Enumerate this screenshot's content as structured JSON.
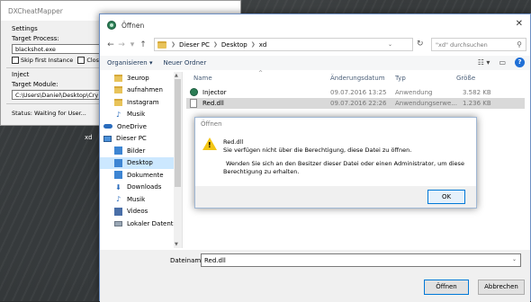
{
  "desktop": {
    "label": "xd"
  },
  "dx_window": {
    "title": "DXCheatMapper",
    "settings_label": "Settings",
    "target_process_label": "Target Process:",
    "target_process_value": "blackshot.exe",
    "skip_first_instance": "Skip first Instance",
    "close_after": "Close af",
    "inject_label": "Inject",
    "target_module_label": "Target Module:",
    "target_module_value": "C:\\Users\\Daniel\\Desktop\\Cry Bal",
    "status": "Status: Waiting for User..."
  },
  "open_dialog": {
    "title": "Öffnen",
    "breadcrumb": [
      "Dieser PC",
      "Desktop",
      "xd"
    ],
    "search_placeholder": "\"xd\" durchsuchen",
    "toolbar": {
      "organize": "Organisieren ▾",
      "new_folder": "Neuer Ordner"
    },
    "tree": [
      {
        "label": "3europ",
        "icon": "folder-icon"
      },
      {
        "label": "aufnahmen",
        "icon": "folder-icon"
      },
      {
        "label": "Instagram",
        "icon": "folder-icon"
      },
      {
        "label": "Musik",
        "icon": "music-icon"
      },
      {
        "label": "OneDrive",
        "icon": "cloud-icon"
      },
      {
        "label": "Dieser PC",
        "icon": "pc-icon"
      },
      {
        "label": "Bilder",
        "icon": "pictures-icon"
      },
      {
        "label": "Desktop",
        "icon": "desktop-icon"
      },
      {
        "label": "Dokumente",
        "icon": "documents-icon"
      },
      {
        "label": "Downloads",
        "icon": "downloads-icon"
      },
      {
        "label": "Musik",
        "icon": "music-icon"
      },
      {
        "label": "Videos",
        "icon": "videos-icon"
      },
      {
        "label": "Lokaler Datenträ",
        "icon": "drive-icon"
      }
    ],
    "columns": {
      "name": "Name",
      "date": "Änderungsdatum",
      "type": "Typ",
      "size": "Größe"
    },
    "files": [
      {
        "name": "Injector",
        "date": "09.07.2016 13:25",
        "type": "Anwendung",
        "size": "3.582 KB"
      },
      {
        "name": "Red.dll",
        "date": "09.07.2016 22:26",
        "type": "Anwendungserwe...",
        "size": "1.236 KB"
      }
    ],
    "filename_label": "Dateiname:",
    "filename_value": "Red.dll",
    "open_button": "Öffnen",
    "cancel_button": "Abbrechen"
  },
  "error_box": {
    "title": "Öffnen",
    "line1": "Red.dll",
    "line2": "Sie verfügen nicht über die Berechtigung, diese Datei zu öffnen.",
    "line3": "Wenden Sie sich an den Besitzer dieser Datei oder einen Administrator, um diese",
    "line4": "Berechtigung zu erhalten.",
    "ok_button": "OK"
  }
}
